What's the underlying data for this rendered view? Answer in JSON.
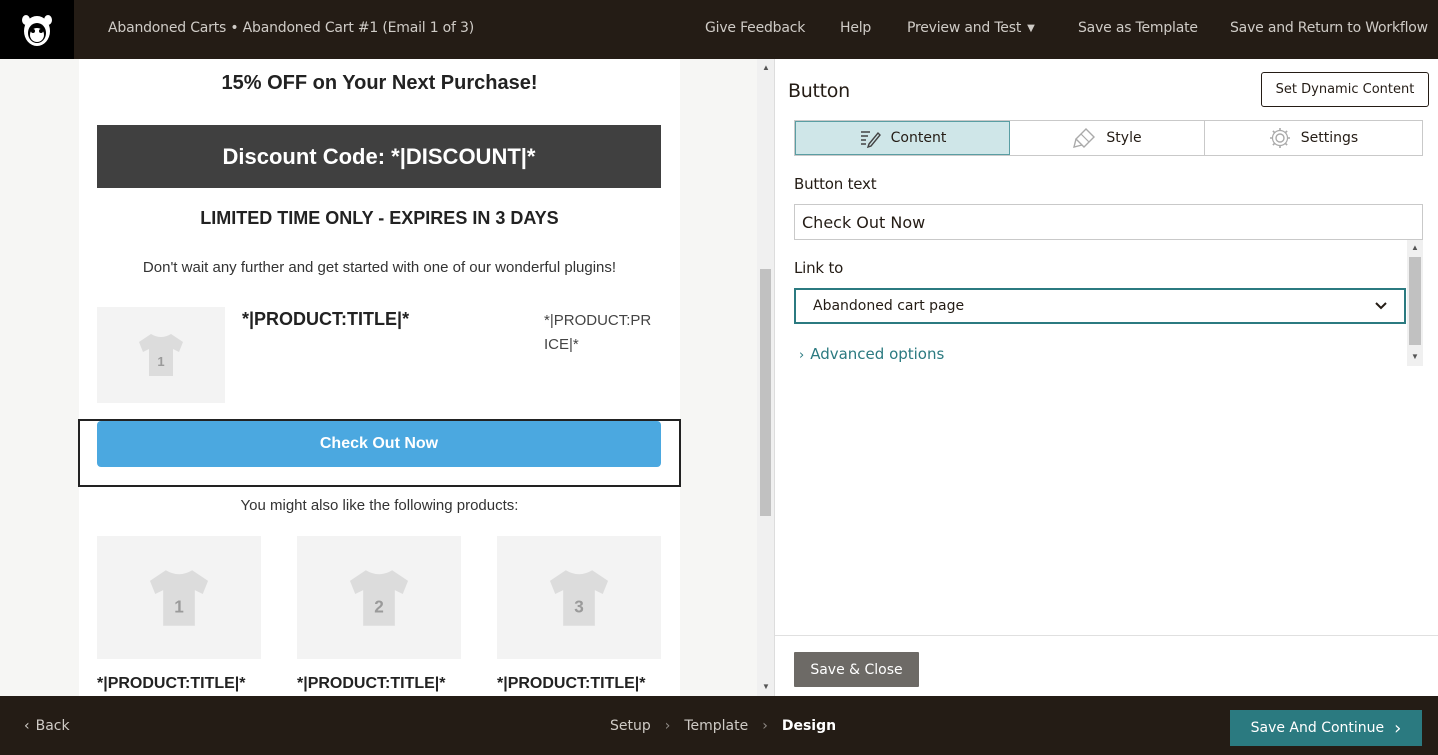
{
  "topbar": {
    "title": "Abandoned Carts • Abandoned Cart #1 (Email 1 of 3)",
    "nav": [
      "Give Feedback",
      "Help",
      "Preview and Test",
      "Save as Template",
      "Save and Return to Workflow"
    ]
  },
  "email": {
    "headline": "15% OFF on Your Next Purchase!",
    "discount": "Discount Code: *|DISCOUNT|*",
    "limited": "LIMITED TIME ONLY - EXPIRES IN 3 DAYS",
    "body": "Don't wait any further and get started with one of our wonderful plugins!",
    "product": {
      "image_num": "1",
      "title": "*|PRODUCT:TITLE|*",
      "price": "*|PRODUCT:PRICE|*"
    },
    "button": "Check Out Now",
    "also": "You might also like the following products:",
    "recs": [
      {
        "num": "1",
        "title": "*|PRODUCT:TITLE|*"
      },
      {
        "num": "2",
        "title": "*|PRODUCT:TITLE|*"
      },
      {
        "num": "3",
        "title": "*|PRODUCT:TITLE|*"
      }
    ]
  },
  "panel": {
    "title": "Button",
    "dynamic": "Set Dynamic Content",
    "tabs": [
      "Content",
      "Style",
      "Settings"
    ],
    "button_text_label": "Button text",
    "button_text_value": "Check Out Now",
    "link_label": "Link to",
    "link_value": "Abandoned cart page",
    "advanced": "Advanced options",
    "save_close": "Save & Close"
  },
  "bottom": {
    "back": "Back",
    "steps": [
      "Setup",
      "Template",
      "Design"
    ],
    "continue": "Save And Continue"
  },
  "colors": {
    "brand_dark": "#241c15",
    "teal": "#2b7a80",
    "button_blue": "#4ba8e0"
  }
}
